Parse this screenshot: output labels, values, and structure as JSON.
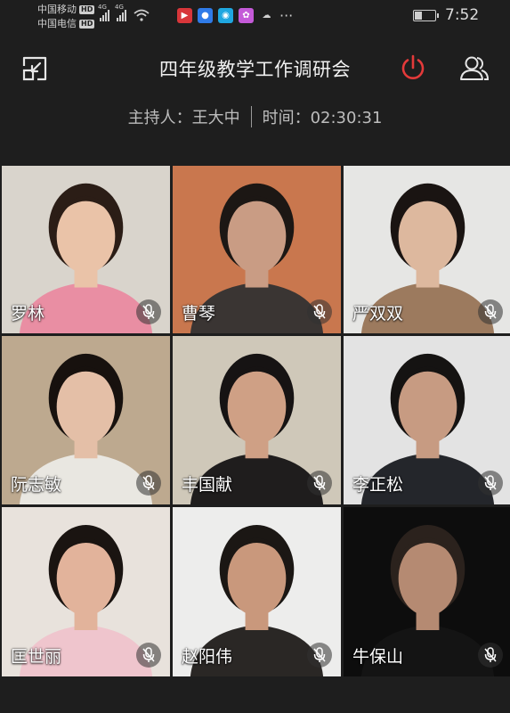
{
  "status_bar": {
    "carrier_1": "中国移动",
    "carrier_2": "中国电信",
    "hd_label": "HD",
    "network_1": "4G",
    "network_2": "4G",
    "battery_level": 0.35,
    "time": "7:52"
  },
  "header": {
    "title": "四年级教学工作调研会",
    "host_label": "主持人：王大中",
    "time_label": "时间：02:30:31"
  },
  "colors": {
    "background": "#1e1e1e",
    "end_meeting_red": "#e43a3a",
    "text_light": "#f0f0f0",
    "text_muted": "#bdbdbd"
  },
  "participants": [
    {
      "name": "罗林",
      "muted": true,
      "bg": "#d9d4cc",
      "clothes": "#e98ea3",
      "hair": "#2b1d16",
      "skin": "#eac3a8"
    },
    {
      "name": "曹琴",
      "muted": true,
      "bg": "#c9774e",
      "clothes": "#3a3533",
      "hair": "#1c1714",
      "skin": "#c99c84"
    },
    {
      "name": "严双双",
      "muted": true,
      "bg": "#e6e6e4",
      "clothes": "#9c7a5e",
      "hair": "#1a1412",
      "skin": "#ddb89e"
    },
    {
      "name": "阮志敏",
      "muted": true,
      "bg": "#bda98f",
      "clothes": "#e9e7e1",
      "hair": "#17110e",
      "skin": "#e4bfa7"
    },
    {
      "name": "丰国献",
      "muted": true,
      "bg": "#cfc8b9",
      "clothes": "#1f1d1d",
      "hair": "#161313",
      "skin": "#cfa085"
    },
    {
      "name": "李正松",
      "muted": true,
      "bg": "#e3e3e3",
      "clothes": "#24262b",
      "hair": "#151312",
      "skin": "#c79b82"
    },
    {
      "name": "匡世丽",
      "muted": true,
      "bg": "#e8e2dc",
      "clothes": "#efc5cd",
      "hair": "#1a1411",
      "skin": "#e2b39b"
    },
    {
      "name": "赵阳伟",
      "muted": true,
      "bg": "#ededec",
      "clothes": "#2a2725",
      "hair": "#1b1714",
      "skin": "#c9987c"
    },
    {
      "name": "牛保山",
      "muted": true,
      "bg": "#0d0d0d",
      "clothes": "#141414",
      "hair": "#2b221d",
      "skin": "#b58a72"
    }
  ]
}
